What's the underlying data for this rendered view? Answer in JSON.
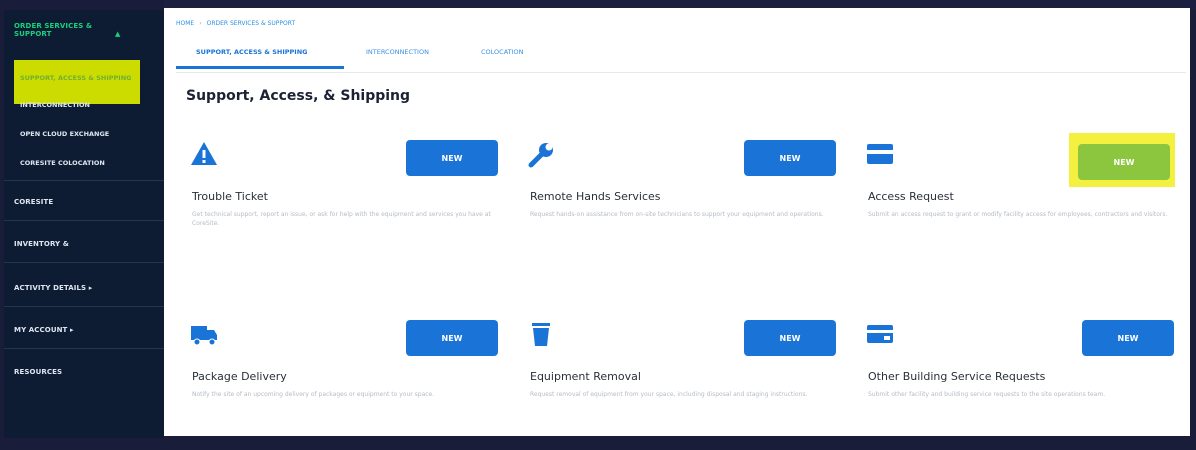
{
  "sidebar": {
    "section_title": "ORDER SERVICES & SUPPORT",
    "caret": "▲",
    "sub_items": [
      {
        "label": "SUPPORT, ACCESS & SHIPPING",
        "active": true
      },
      {
        "label": "INTERCONNECTION"
      },
      {
        "label": "OPEN CLOUD EXCHANGE"
      },
      {
        "label": "CORESITE COLOCATION"
      }
    ],
    "items": [
      {
        "label": "CORESITE"
      },
      {
        "label": "INVENTORY &"
      },
      {
        "label": "ACTIVITY DETAILS ▸"
      },
      {
        "label": "MY ACCOUNT ▸"
      },
      {
        "label": "RESOURCES"
      }
    ]
  },
  "breadcrumb": {
    "home": "HOME",
    "separator": "›",
    "current": "ORDER SERVICES & SUPPORT"
  },
  "tabs": [
    {
      "label": "SUPPORT, ACCESS & SHIPPING",
      "active": true
    },
    {
      "label": "INTERCONNECTION"
    },
    {
      "label": "COLOCATION"
    }
  ],
  "page_title": "Support, Access, & Shipping",
  "cards": [
    {
      "title": "Trouble Ticket",
      "icon": "warning-icon",
      "button": "NEW",
      "desc": "Get technical support, report an issue, or ask for help with the equipment and services you have at CoreSite."
    },
    {
      "title": "Remote Hands Services",
      "icon": "wrench-icon",
      "button": "NEW",
      "desc": "Request hands-on assistance from on-site technicians to support your equipment and operations."
    },
    {
      "title": "Access Request",
      "icon": "card-icon",
      "button": "NEW",
      "highlighted": true,
      "desc": "Submit an access request to grant or modify facility access for employees, contractors and visitors."
    },
    {
      "title": "Package Delivery",
      "icon": "truck-icon",
      "button": "NEW",
      "desc": "Notify the site of an upcoming delivery of packages or equipment to your space."
    },
    {
      "title": "Equipment Removal",
      "icon": "trash-icon",
      "button": "NEW",
      "desc": "Request removal of equipment from your space, including disposal and staging instructions."
    },
    {
      "title": "Other Building Service Requests",
      "icon": "building-icon",
      "button": "NEW",
      "desc": "Submit other facility and building service requests to the site operations team."
    }
  ],
  "colors": {
    "accent": "#1a73d6",
    "highlight": "#f4f040",
    "active_nav": "#cddc00",
    "green_btn": "#8cc63f",
    "sidebar": "#0d1c33"
  }
}
